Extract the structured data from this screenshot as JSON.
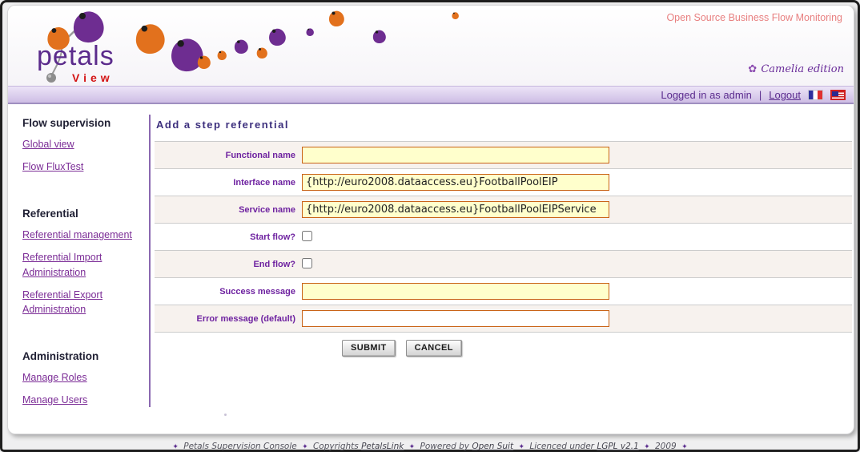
{
  "header": {
    "logo_brand": "petals",
    "logo_sub": "View",
    "tagline": "Open Source Business Flow Monitoring",
    "edition": "Camelia edition",
    "flower_glyph": "✿"
  },
  "loginbar": {
    "status_text": "Logged in as admin",
    "separator": "|",
    "logout_label": "Logout"
  },
  "sidebar": {
    "sections": [
      {
        "heading": "Flow supervision",
        "links": [
          {
            "label": "Global view"
          },
          {
            "label": "Flow FluxTest"
          }
        ]
      },
      {
        "heading": "Referential",
        "links": [
          {
            "label": "Referential management"
          },
          {
            "label": "Referential Import Administration"
          },
          {
            "label": "Referential Export Administration"
          }
        ]
      },
      {
        "heading": "Administration",
        "links": [
          {
            "label": "Manage Roles"
          },
          {
            "label": "Manage Users"
          }
        ]
      }
    ]
  },
  "form": {
    "title": "Add a step referential",
    "fields": [
      {
        "label": "Functional name",
        "type": "text",
        "value": ""
      },
      {
        "label": "Interface name",
        "type": "text",
        "value": "{http://euro2008.dataaccess.eu}FootballPoolEIP"
      },
      {
        "label": "Service name",
        "type": "text",
        "value": "{http://euro2008.dataaccess.eu}FootballPoolEIPService"
      },
      {
        "label": "Start flow?",
        "type": "checkbox",
        "checked": false
      },
      {
        "label": "End flow?",
        "type": "checkbox",
        "checked": false
      },
      {
        "label": "Success message",
        "type": "text",
        "value": ""
      },
      {
        "label": "Error message (default)",
        "type": "text",
        "value": ""
      }
    ],
    "submit_label": "SUBMIT",
    "cancel_label": "CANCEL"
  },
  "footer": {
    "bullet": "✦",
    "item1": "Petals Supervision Console",
    "item2_prefix": "Copyrights",
    "item2_link": "PetalsLink",
    "item3_prefix": "Powered by",
    "item3_link": "Open Suit",
    "item4_prefix": "Licenced under",
    "item4_link": "LGPL v2.1",
    "item5": "2009"
  },
  "colors": {
    "accent_purple": "#7b2c96",
    "title_indigo": "#3c2f7d",
    "input_border_orange": "#c96316",
    "input_bg_yellow": "#ffffcc",
    "row_beige": "#f7f2ee",
    "tagline_salmon": "#e88080",
    "loginbar_lavender": "#cebde5",
    "logo_red": "#d41414"
  }
}
